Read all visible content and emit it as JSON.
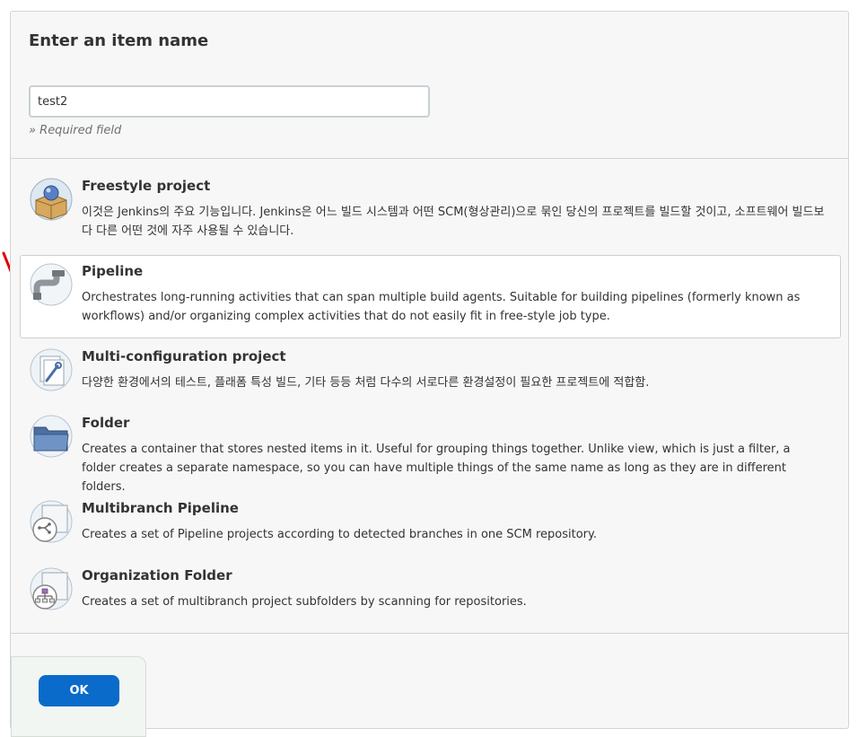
{
  "form": {
    "heading": "Enter an item name",
    "name_value": "test2",
    "required_note": "» Required field"
  },
  "items": [
    {
      "title": "Freestyle project",
      "description": "이것은 Jenkins의 주요 기능입니다. Jenkins은 어느 빌드 시스템과 어떤 SCM(형상관리)으로 묶인 당신의 프로젝트를 빌드할 것이고, 소프트웨어 빌드보다 다른 어떤 것에 자주 사용될 수 있습니다.",
      "icon": "freestyle-box-icon"
    },
    {
      "title": "Pipeline",
      "description": "Orchestrates long-running activities that can span multiple build agents. Suitable for building pipelines (formerly known as workflows) and/or organizing complex activities that do not easily fit in free-style job type.",
      "icon": "pipeline-pipe-icon",
      "selected": true
    },
    {
      "title": "Multi-configuration project",
      "description": "다양한 환경에서의 테스트, 플래폼 특성 빌드, 기타 등등 처럼 다수의 서로다른 환경설정이 필요한 프로젝트에 적합함.",
      "icon": "multi-config-icon"
    },
    {
      "title": "Folder",
      "description": "Creates a container that stores nested items in it. Useful for grouping things together. Unlike view, which is just a filter, a folder creates a separate namespace, so you can have multiple things of the same name as long as they are in different folders.",
      "icon": "folder-icon"
    },
    {
      "title": "Multibranch Pipeline",
      "description": "Creates a set of Pipeline projects according to detected branches in one SCM repository.",
      "icon": "multibranch-icon"
    },
    {
      "title": "Organization Folder",
      "description": "Creates a set of multibranch project subfolders by scanning for repositories.",
      "icon": "organization-folder-icon"
    }
  ],
  "actions": {
    "ok_label": "OK"
  },
  "colors": {
    "ok_button": "#0b6bcb",
    "annotation_check": "#e00000"
  }
}
